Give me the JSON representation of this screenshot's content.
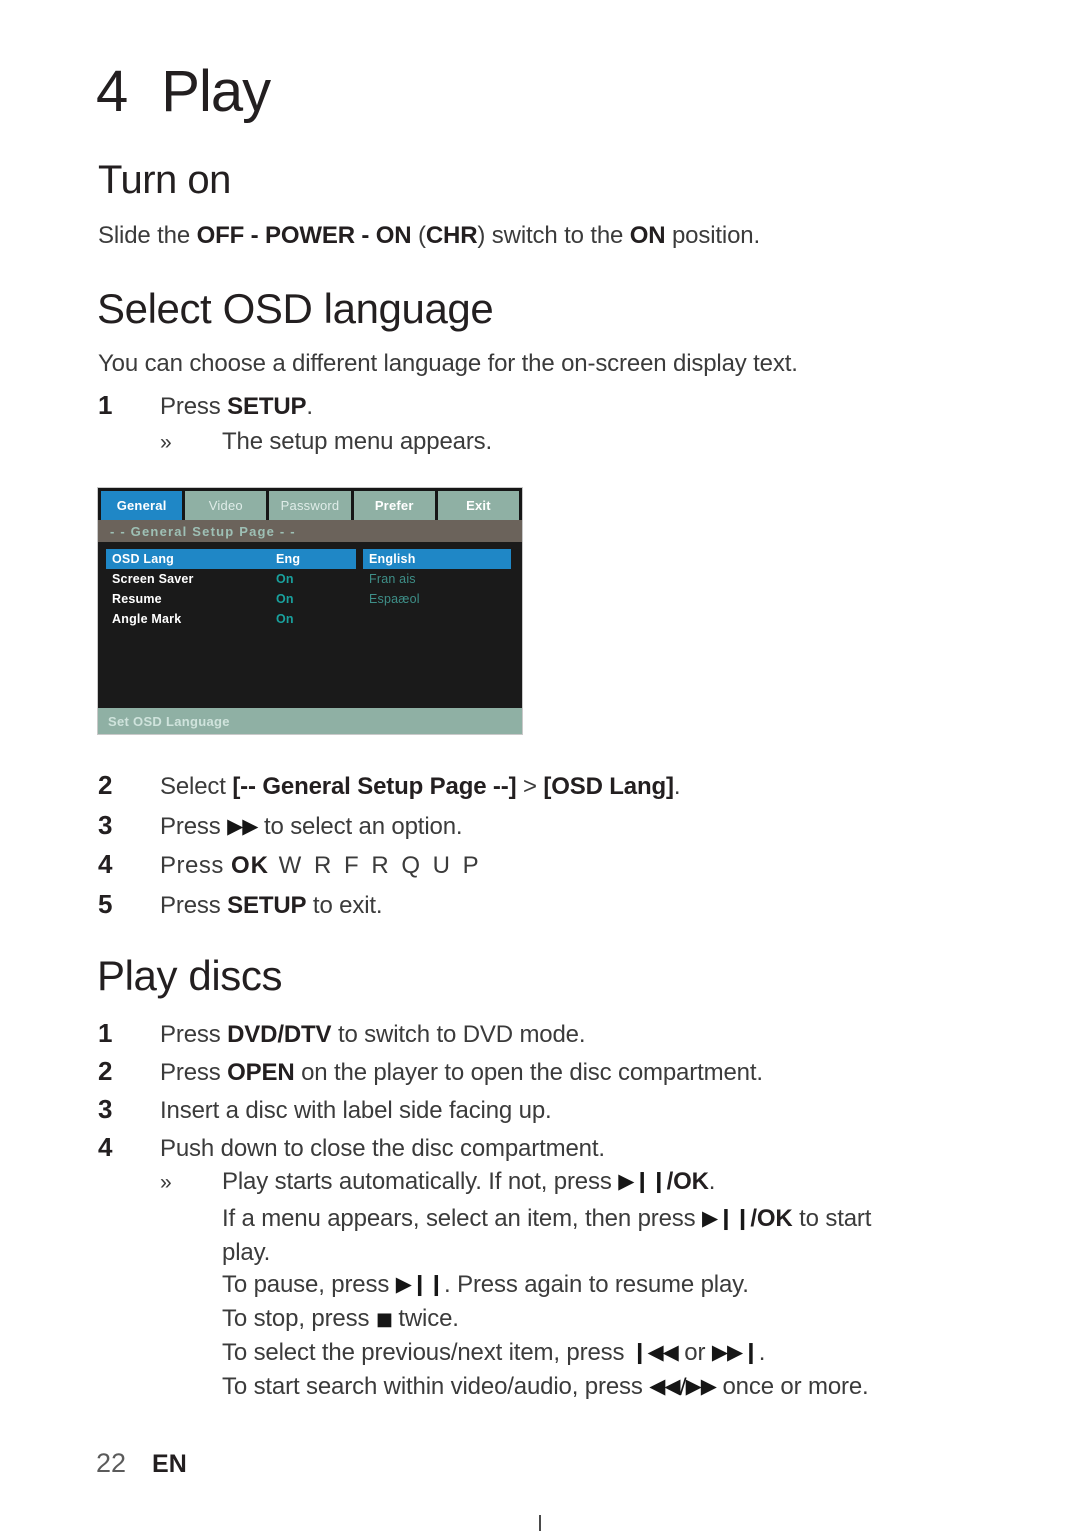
{
  "chapter": {
    "number": "4",
    "title": "Play"
  },
  "sections": {
    "turn_on": {
      "heading": "Turn on",
      "paragraph_prefix": "Slide the ",
      "paragraph_b1": "OFF - POWER - ON",
      "paragraph_mid": " (",
      "paragraph_b2": "CHR",
      "paragraph_mid2": ") switch to the ",
      "paragraph_b3": "ON",
      "paragraph_suffix": " position."
    },
    "select_osd": {
      "heading": "Select OSD language",
      "intro": "You can choose a different language for the on-screen display text.",
      "steps": [
        {
          "num": "1",
          "pre": "Press ",
          "bold": "SETUP",
          "post": "."
        },
        {
          "num": "2",
          "pre": "Select ",
          "bold": "[-- General Setup Page --]",
          "mid": " > ",
          "bold2": "[OSD Lang]",
          "post": "."
        },
        {
          "num": "3",
          "pre": "Press ",
          "glyph": "▶▶",
          "post": " to select an option."
        },
        {
          "num": "4",
          "pre": "Press ",
          "bold": "OK",
          "post": "  W R  F R Q  U P"
        },
        {
          "num": "5",
          "pre": "Press ",
          "bold": "SETUP",
          "post": " to exit."
        }
      ],
      "step1_sub": "The setup menu appears."
    },
    "play_discs": {
      "heading": "Play discs",
      "steps": [
        {
          "num": "1",
          "pre": "Press ",
          "bold": "DVD/DTV",
          "post": " to switch to DVD mode."
        },
        {
          "num": "2",
          "pre": "Press ",
          "bold": "OPEN",
          "post": " on the player to open the disc compartment."
        },
        {
          "num": "3",
          "pre": "Insert a disc with label side facing up.",
          "bold": "",
          "post": ""
        },
        {
          "num": "4",
          "pre": "Push down to close the disc compartment.",
          "bold": "",
          "post": ""
        }
      ],
      "notes": [
        {
          "marker": "»",
          "pre": "Play starts automatically. If not, press ",
          "glyph": "▶❙❙",
          "bold": "/OK",
          "post": "."
        },
        {
          "marker": "",
          "pre": "If a menu appears, select an item, then press ",
          "glyph": "▶❙❙",
          "bold": "/OK",
          "post": " to start"
        },
        {
          "marker": "",
          "pre": "play.",
          "glyph": "",
          "bold": "",
          "post": ""
        },
        {
          "marker": "",
          "pre": "To pause, press ",
          "glyph": "▶❙❙",
          "bold": "",
          "post": ". Press again to resume play."
        },
        {
          "marker": "",
          "pre": "To stop, press ",
          "glyph": "■",
          "bold": "",
          "post": " twice."
        },
        {
          "marker": "",
          "pre": "To select the previous/next item, press ",
          "glyph": "❙◀◀",
          "bold": "",
          "post": " or ",
          "glyph2": "▶▶❙",
          "post2": "."
        },
        {
          "marker": "",
          "pre": "To start search within video/audio, press ",
          "glyph": "◀◀/▶▶",
          "bold": "",
          "post": " once or more."
        }
      ]
    }
  },
  "osd_screenshot": {
    "tabs": [
      {
        "label": "General",
        "active": true
      },
      {
        "label": "Video",
        "active": false
      },
      {
        "label": "Password",
        "active": false
      },
      {
        "label": "Prefer",
        "active": false
      },
      {
        "label": "Exit",
        "active": false
      }
    ],
    "page_title": "- -  General Setup Page  - -",
    "settings": [
      {
        "label": "OSD  Lang",
        "value": "Eng",
        "highlighted": true
      },
      {
        "label": "Screen Saver",
        "value": "On",
        "highlighted": false
      },
      {
        "label": "Resume",
        "value": "On",
        "highlighted": false
      },
      {
        "label": "Angle Mark",
        "value": "On",
        "highlighted": false
      }
    ],
    "options": [
      {
        "label": "English",
        "highlighted": true
      },
      {
        "label": "Fran ais",
        "highlighted": false
      },
      {
        "label": "Espaæol",
        "highlighted": false
      }
    ],
    "status": "Set OSD Language",
    "colors": {
      "active_tab": "#1f87c6",
      "tab": "#8fb0a4",
      "subbar": "#6b635b",
      "background": "#1a1a1a",
      "value_text": "#19a19d"
    }
  },
  "footer": {
    "page_number": "22",
    "language": "EN"
  }
}
